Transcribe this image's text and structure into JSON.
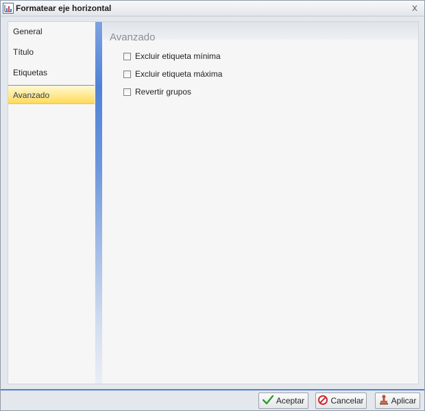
{
  "window": {
    "title": "Formatear eje horizontal",
    "close_glyph": "x"
  },
  "sidebar": {
    "items": [
      {
        "label": "General"
      },
      {
        "label": "Título"
      },
      {
        "label": "Etiquetas"
      },
      {
        "label": "Avanzado",
        "selected": true
      }
    ]
  },
  "panel": {
    "title": "Avanzado",
    "options": [
      {
        "label": "Excluir etiqueta mínima",
        "checked": false
      },
      {
        "label": "Excluir etiqueta máxima",
        "checked": false
      },
      {
        "label": "Revertir grupos",
        "checked": false
      }
    ]
  },
  "footer": {
    "accept_label": "Aceptar",
    "cancel_label": "Cancelar",
    "apply_label": "Aplicar"
  },
  "colors": {
    "accent": "#4f7fd1",
    "selected_item": "#ffe98f",
    "accept_icon": "#2e9b2e",
    "cancel_icon": "#cc2a2a"
  },
  "icons": {
    "title": "axis-chart-icon",
    "close": "close-icon",
    "accept": "checkmark-icon",
    "cancel": "no-entry-icon",
    "apply": "stamp-icon"
  }
}
